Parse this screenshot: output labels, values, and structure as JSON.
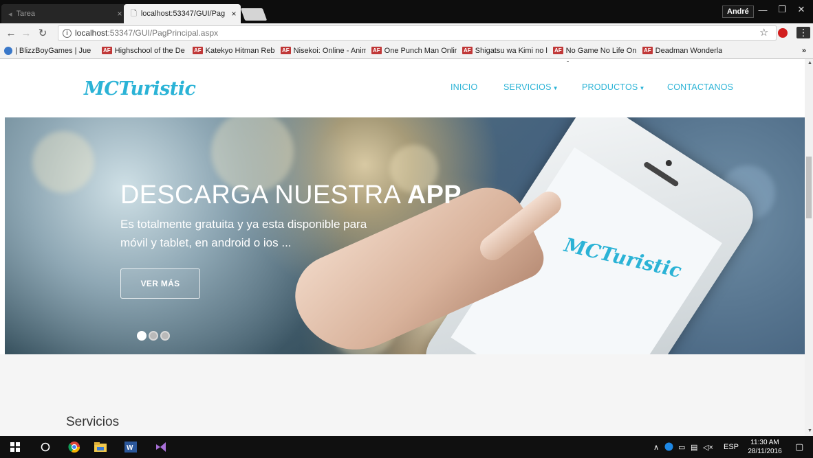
{
  "browser": {
    "tabs": [
      {
        "title": "Tarea",
        "active": false
      },
      {
        "title": "localhost:53347/GUI/Pag",
        "active": true
      }
    ],
    "user": "André",
    "url_host": "localhost",
    "url_path": ":53347/GUI/PagPrincipal.aspx",
    "bookmarks": [
      "| BlizzBoyGames | Jue",
      "Highschool of the De",
      "Katekyo Hitman Rebo",
      "Nisekoi: Online - Anim",
      "One Punch Man Onlir",
      "Shigatsu wa Kimi no l",
      "No Game No Life Onl",
      "Deadman Wonderlan"
    ],
    "bookmark_badge": "AF",
    "more": "»"
  },
  "site": {
    "logo": "MCTuristic",
    "nav": {
      "inicio": "INICIO",
      "servicios": "SERVICIOS",
      "productos": "PRODUCTOS",
      "contactanos": "CONTACTANOS"
    },
    "hero": {
      "title_main": "DESCARGA NUESTRA ",
      "title_bold": "APP",
      "subtitle": "Es totalmente gratuita y ya esta disponible para móvil y tablet, en android o ios ...",
      "button": "VER MÁS",
      "phone_logo": "MCTuristic",
      "slides": 3,
      "active_slide": 1
    },
    "services_heading": "Servicios"
  },
  "taskbar": {
    "lang": "ESP",
    "time": "11:30 AM",
    "date": "28/11/2016"
  },
  "colors": {
    "brand": "#2bb3d6",
    "tabstrip": "#0d0d0d",
    "taskbar": "#101010"
  }
}
